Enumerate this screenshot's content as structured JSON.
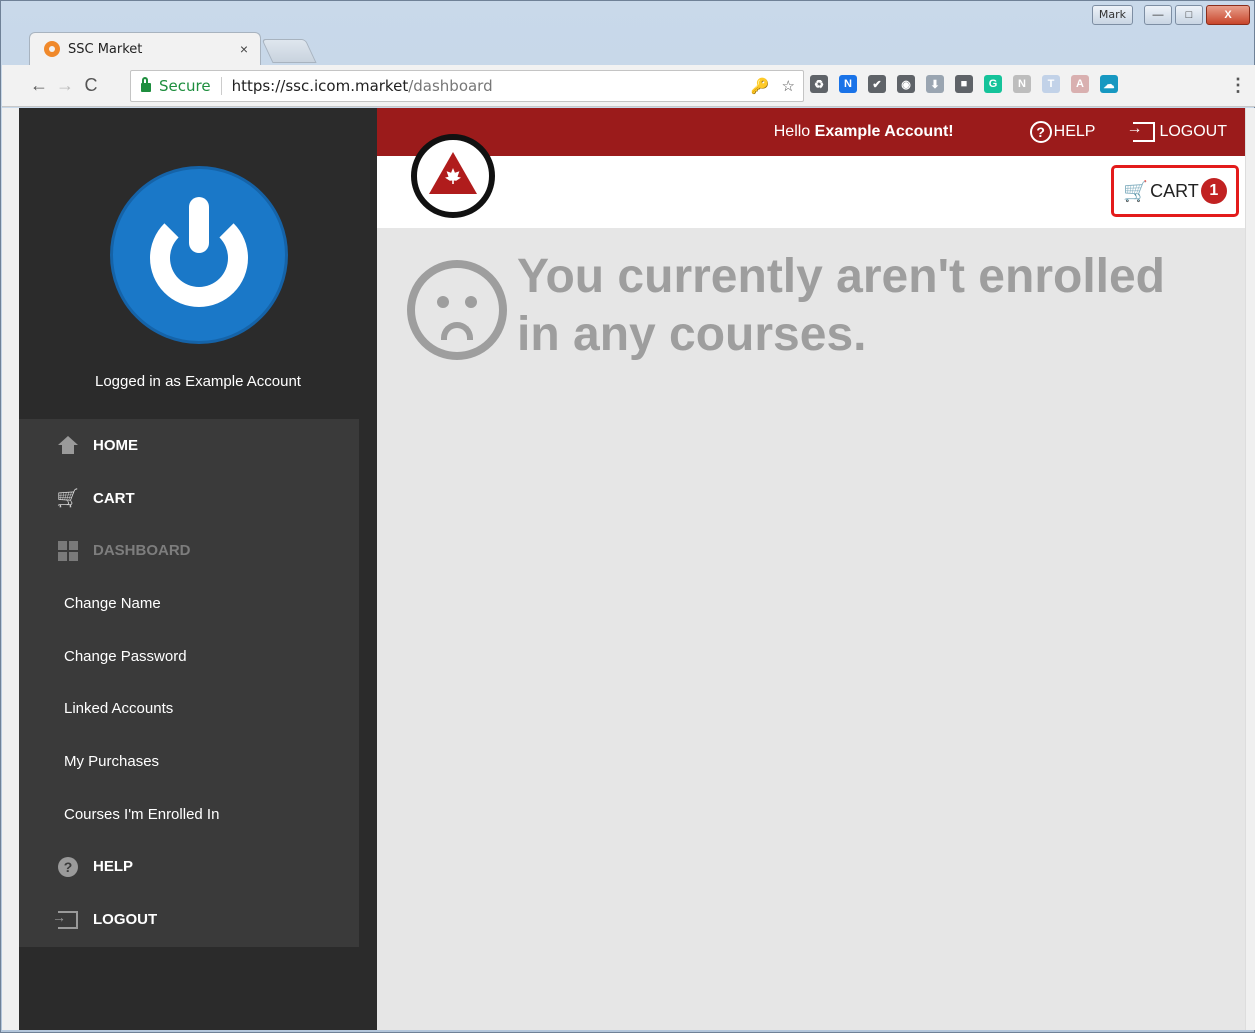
{
  "window": {
    "user_badge": "Mark",
    "minimize": "—",
    "maximize": "□",
    "close": "X"
  },
  "tab": {
    "title": "SSC Market",
    "close": "×"
  },
  "toolbar": {
    "back": "←",
    "forward": "→",
    "reload": "C",
    "secure_label": "Secure",
    "url_host": "https://ssc.icom.market",
    "url_path": "/dashboard",
    "key_icon": "🔑",
    "star_icon": "☆",
    "menu_dots": "⋮"
  },
  "extensions": [
    {
      "name": "recycle-extension-icon",
      "glyph": "♻",
      "color": "#5f6368"
    },
    {
      "name": "new-extension-icon",
      "glyph": "N",
      "color": "#1a73e8"
    },
    {
      "name": "checkbox-extension-icon",
      "glyph": "✔",
      "color": "#5f6368"
    },
    {
      "name": "eye-extension-icon",
      "glyph": "◉",
      "color": "#5f6368"
    },
    {
      "name": "download-extension-icon",
      "glyph": "⬇",
      "color": "#9aa5b1"
    },
    {
      "name": "square-extension-icon",
      "glyph": "■",
      "color": "#5f6368"
    },
    {
      "name": "grammarly-extension-icon",
      "glyph": "G",
      "color": "#15c39a"
    },
    {
      "name": "notes-extension-icon",
      "glyph": "N",
      "color": "#bdbdbd"
    },
    {
      "name": "tag-extension-icon",
      "glyph": "T",
      "color": "#c2d2e8"
    },
    {
      "name": "pdf-extension-icon",
      "glyph": "A",
      "color": "#d9b0b0"
    },
    {
      "name": "salesforce-extension-icon",
      "glyph": "☁",
      "color": "#1798c1"
    }
  ],
  "sidebar": {
    "logged_in": "Logged in as Example Account",
    "items": [
      {
        "label": "HOME",
        "type": "main",
        "icon": "home-icon"
      },
      {
        "label": "CART",
        "type": "main",
        "icon": "cart-icon"
      },
      {
        "label": "DASHBOARD",
        "type": "main",
        "icon": "dashboard-icon",
        "active": true
      },
      {
        "label": "Change Name",
        "type": "sub"
      },
      {
        "label": "Change Password",
        "type": "sub"
      },
      {
        "label": "Linked Accounts",
        "type": "sub"
      },
      {
        "label": "My Purchases",
        "type": "sub"
      },
      {
        "label": "Courses I'm Enrolled In",
        "type": "sub"
      },
      {
        "label": "HELP",
        "type": "main",
        "icon": "help-icon"
      },
      {
        "label": "LOGOUT",
        "type": "main",
        "icon": "logout-icon"
      }
    ]
  },
  "header": {
    "hello_prefix": "Hello ",
    "hello_name": "Example Account!",
    "help": "HELP",
    "help_glyph": "?",
    "logout": "LOGOUT"
  },
  "cart": {
    "label": "CART",
    "count": "1",
    "icon": "🛒"
  },
  "main": {
    "empty_message": "You currently aren't enrolled in any courses."
  },
  "colors": {
    "brand_red": "#9b1b1b",
    "highlight_red": "#e31b1b",
    "sidebar_bg": "#2b2b2b",
    "menu_bg": "#3a3a3a"
  }
}
